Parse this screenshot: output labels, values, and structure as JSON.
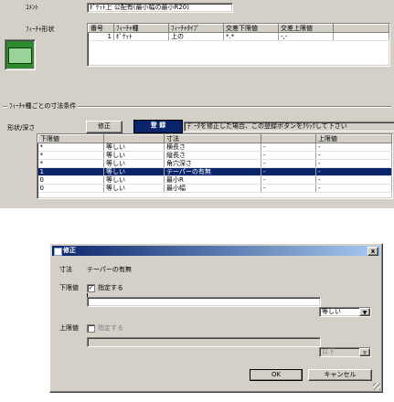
{
  "top": {
    "comment_label": "ｺﾒﾝﾄ",
    "comment_value": "ﾎﾟｹｯﾄ上 公配有(最小幅の最小R20)",
    "feature_shape_label": "ﾌｨｰﾁｬ形状",
    "table_headers": [
      "番号",
      "ﾌｨｰﾁｬ種",
      "ﾌｨｰﾁｬﾀｲﾌﾟ",
      "交差下限値",
      "交差上限値"
    ],
    "table_rows": [
      [
        "1",
        "ﾎﾟｹｯﾄ",
        "上の",
        "*.*",
        "-,-"
      ]
    ]
  },
  "conditions": {
    "group_label": "ﾌｨｰﾁｬ種ごとの寸法条件",
    "shape_label": "形状/深さ",
    "modify_button": "修正",
    "register_button": "登 録",
    "hint": "ﾃﾞｰﾀを修正した場合、この登録ボタンをｸﾘｯｸして下さい",
    "headers": [
      "下限値",
      "",
      "寸法",
      "上限値"
    ],
    "rows": [
      [
        "*",
        "等しい",
        "横長さ",
        "-",
        "-"
      ],
      [
        "*",
        "等しい",
        "縦長さ",
        "-",
        "-"
      ],
      [
        "*",
        "等しい",
        "角穴深さ",
        "-",
        "-"
      ],
      [
        "1",
        "等しい",
        "テーパーの有無",
        "-",
        "-"
      ],
      [
        "0",
        "等しい",
        "最小R",
        "-",
        "-"
      ],
      [
        "0",
        "等しい",
        "最小幅",
        "-",
        "-"
      ]
    ],
    "selected_row": 3
  },
  "dialog": {
    "title": "修正",
    "close": "x",
    "dim_label": "寸法",
    "dim_value": "テーパーの有無",
    "lower_label": "下限値",
    "lower_check": "指定する",
    "lower_checked": true,
    "lower_combo": "等しい",
    "upper_label": "上限値",
    "upper_check": "指定する",
    "upper_checked": false,
    "upper_combo": "以下",
    "ok": "OK",
    "cancel": "キャンセル"
  },
  "colors": {
    "title_bar": "#0a246a",
    "window_bg": "#d4d0c8",
    "selection": "#0a246a",
    "register_button": "#0a246a"
  }
}
